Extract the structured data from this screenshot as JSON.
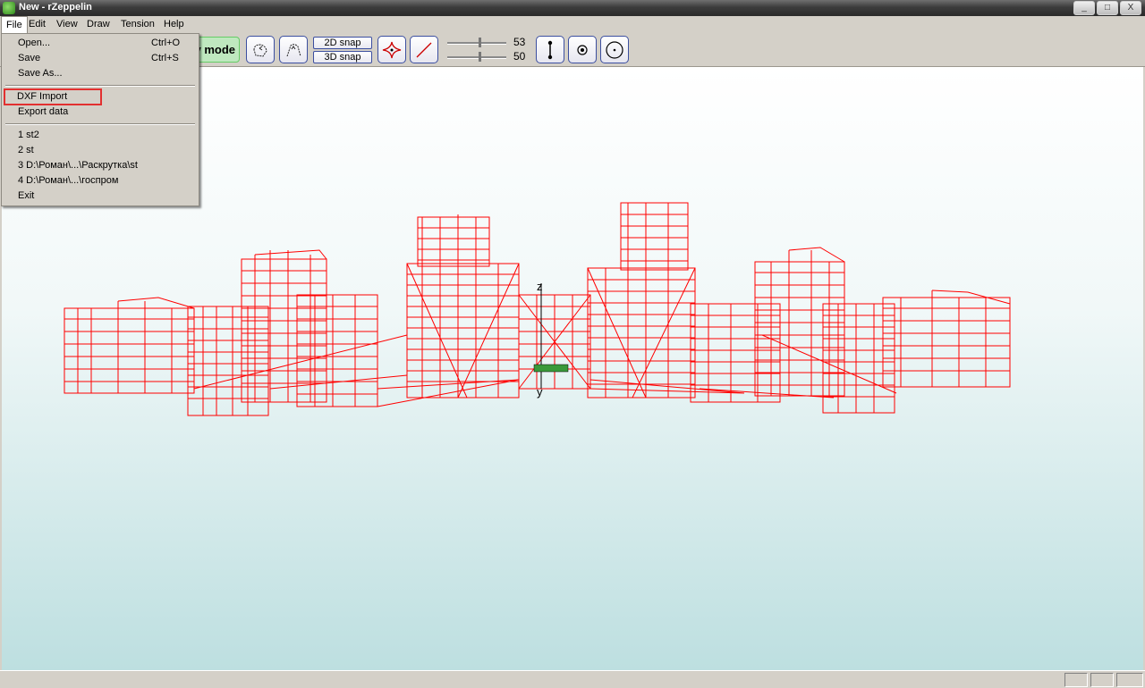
{
  "window": {
    "title": "New - rZeppelin",
    "min": "_",
    "max": "□",
    "close": "X"
  },
  "menubar": {
    "items": [
      "File",
      "Edit",
      "View",
      "Draw",
      "Tension",
      "Help"
    ]
  },
  "toolbar": {
    "mode_label": "v mode",
    "snap_2d": "2D snap",
    "snap_3d": "3D snap",
    "slider1_value": "53",
    "slider2_value": "50"
  },
  "file_menu": {
    "open": "Open...",
    "open_shortcut": "Ctrl+O",
    "save": "Save",
    "save_shortcut": "Ctrl+S",
    "save_as": "Save As...",
    "dxf_import": "DXF Import",
    "export_data": "Export  data",
    "recent1": "1 st2",
    "recent2": "2 st",
    "recent3": "3 D:\\Роман\\...\\Раскрутка\\st",
    "recent4": "4 D:\\Роман\\...\\госпром",
    "exit": "Exit"
  },
  "viewport": {
    "axis_z": "z",
    "axis_y": "y",
    "model_color": "#ff0000"
  }
}
